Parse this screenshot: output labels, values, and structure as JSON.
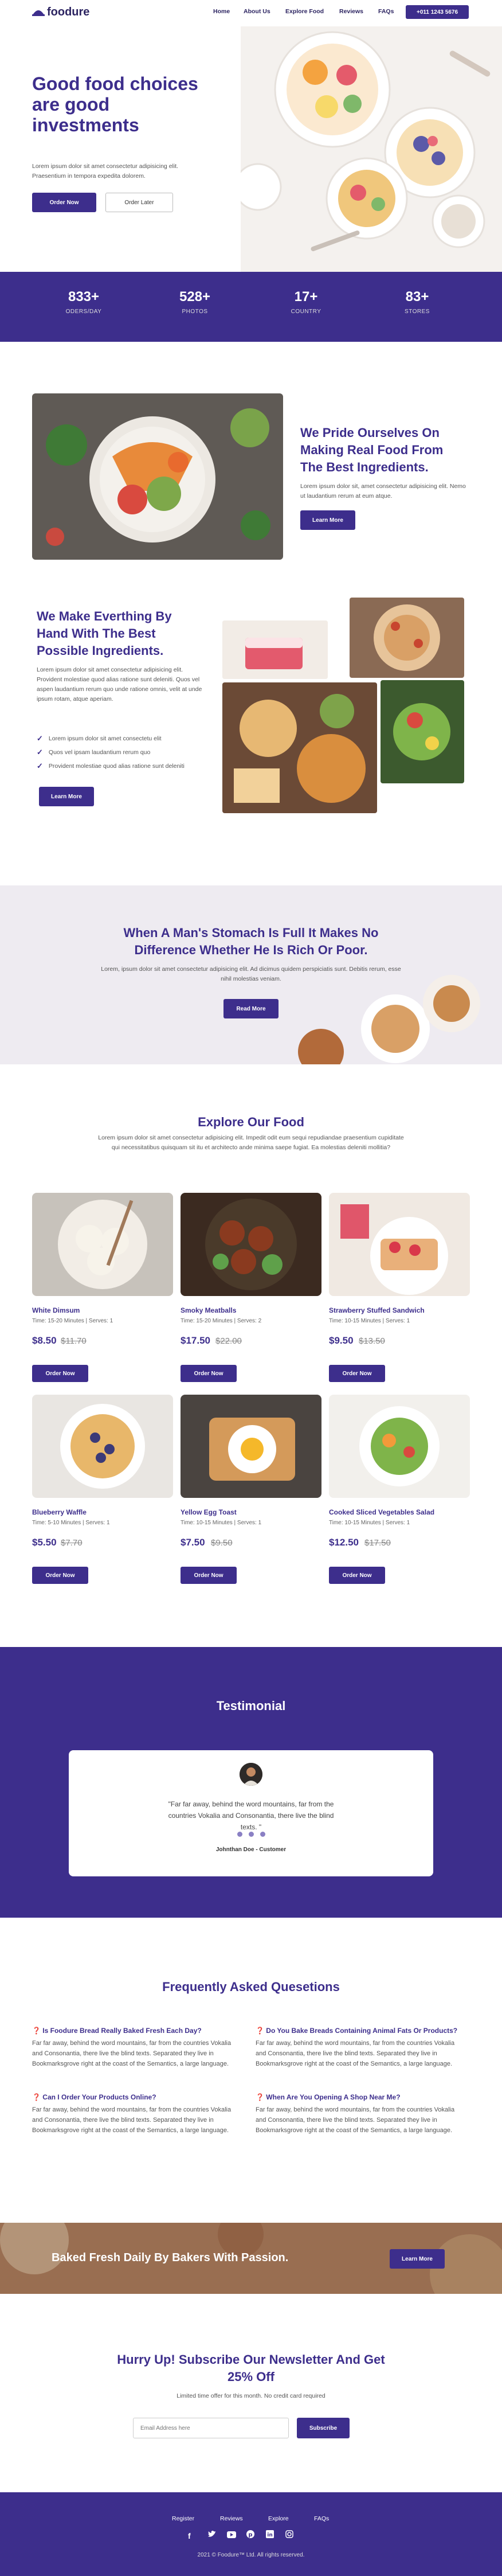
{
  "header": {
    "logo": "foodure",
    "nav": [
      "Home",
      "About Us",
      "Explore Food",
      "Reviews",
      "FAQs"
    ],
    "phone": "+011 1243 5676"
  },
  "hero": {
    "title_line1": "Good food choices",
    "title_line2": "are good",
    "title_line3": "investments",
    "text": "Lorem ipsum dolor sit amet consectetur adipisicing elit. Praesentium in tempora expedita dolorem.",
    "order_now": "Order Now",
    "order_later": "Order Later"
  },
  "stats": [
    {
      "num": "833+",
      "label": "ODERS/DAY"
    },
    {
      "num": "528+",
      "label": "PHOTOS"
    },
    {
      "num": "17+",
      "label": "COUNTRY"
    },
    {
      "num": "83+",
      "label": "STORES"
    }
  ],
  "pride": {
    "title_line1": "We Pride Ourselves On",
    "title_line2": "Making Real Food From",
    "title_line3": "The Best Ingredients.",
    "text": "Lorem ipsum dolor sit, amet consectetur adipisicing elit. Nemo ut laudantium rerum at eum atque.",
    "button": "Learn More"
  },
  "hand": {
    "title_line1": "We Make Everthing By",
    "title_line2": "Hand With The Best",
    "title_line3": "Possible Ingredients.",
    "text": "Lorem ipsum dolor sit amet consectetur adipisicing elit. Provident molestiae quod alias ratione sunt deleniti. Quos vel aspen laudantium rerum quo unde ratione omnis, velit at unde ipsum rotam, atque aperiam.",
    "checks": [
      "Lorem ipsum dolor sit amet consectetu elit",
      "Quos vel ipsam laudantium rerum quo",
      "Provident molestiae quod alias ratione sunt deleniti"
    ],
    "button": "Learn More"
  },
  "quote": {
    "line1": "When A Man's Stomach Is Full It Makes No",
    "line2": "Difference Whether He Is Rich Or Poor.",
    "text": "Lorem, ipsum dolor sit amet consectetur adipisicing elit. Ad dicimus quidem perspiciatis sunt. Debitis rerum, esse nihil molestias veniam.",
    "button": "Read More"
  },
  "explore": {
    "title": "Explore Our Food",
    "text": "Lorem ipsum dolor sit amet consectetur adipisicing elit. Impedit odit eum sequi repudiandae praesentium cupiditate qui necessitatibus quisquam sit itu et architecto ande minima saepe fugiat. Ea molestias deleniti mollitia?",
    "button": "Order Now",
    "items": [
      {
        "name": "White Dimsum",
        "meta": "Time: 15-20 Minutes | Serves: 1",
        "price": "$8.50",
        "old": "$11.70"
      },
      {
        "name": "Smoky Meatballs",
        "meta": "Time: 15-20 Minutes | Serves: 2",
        "price": "$17.50",
        "old": "$22.00"
      },
      {
        "name": "Strawberry Stuffed Sandwich",
        "meta": "Time: 10-15 Minutes | Serves: 1",
        "price": "$9.50",
        "old": "$13.50"
      },
      {
        "name": "Blueberry Waffle",
        "meta": "Time: 5-10 Minutes | Serves: 1",
        "price": "$5.50",
        "old": "$7.70"
      },
      {
        "name": "Yellow Egg Toast",
        "meta": "Time: 10-15 Minutes | Serves: 1",
        "price": "$7.50",
        "old": "$9.50"
      },
      {
        "name": "Cooked Sliced Vegetables Salad",
        "meta": "Time: 10-15 Minutes | Serves: 1",
        "price": "$12.50",
        "old": "$17.50"
      }
    ]
  },
  "testimonial": {
    "title": "Testimonial",
    "quote": "\"Far far away, behind the word mountains, far from the countries Vokalia and Consonantia, there live the blind texts. \"",
    "author": "Johnthan Doe - Customer"
  },
  "faq": {
    "title": "Frequently Asked Quesetions",
    "items": [
      {
        "q": "Is Foodure Bread Really Baked Fresh Each Day?",
        "a": "Far far away, behind the word mountains, far from the countries Vokalia and Consonantia, there live the blind texts. Separated they live in Bookmarksgrove right at the coast of the Semantics, a large language."
      },
      {
        "q": "Do You Bake Breads Containing Animal Fats Or Products?",
        "a": "Far far away, behind the word mountains, far from the countries Vokalia and Consonantia, there live the blind texts. Separated they live in Bookmarksgrove right at the coast of the Semantics, a large language."
      },
      {
        "q": "Can I Order Your Products Online?",
        "a": "Far far away, behind the word mountains, far from the countries Vokalia and Consonantia, there live the blind texts. Separated they live in Bookmarksgrove right at the coast of the Semantics, a large language."
      },
      {
        "q": "When Are You Opening A Shop Near Me?",
        "a": "Far far away, behind the word mountains, far from the countries Vokalia and Consonantia, there live the blind texts. Separated they live in Bookmarksgrove right at the coast of the Semantics, a large language."
      }
    ]
  },
  "banner": {
    "text": "Baked Fresh Daily By Bakers With Passion.",
    "button": "Learn More"
  },
  "newsletter": {
    "title_line1": "Hurry Up! Subscribe Our Newsletter And Get",
    "title_line2": "25% Off",
    "sub": "Limited time offer for this month. No credit card required",
    "placeholder": "Email Address here",
    "button": "Subscribe"
  },
  "footer": {
    "links": [
      "Register",
      "Reviews",
      "Explore",
      "FAQs"
    ],
    "copyright": "2021 © Foodure™ Ltd. All rights reserved."
  },
  "colors": {
    "brand": "#3d2e8c",
    "brand_light": "#4a3a9e"
  }
}
